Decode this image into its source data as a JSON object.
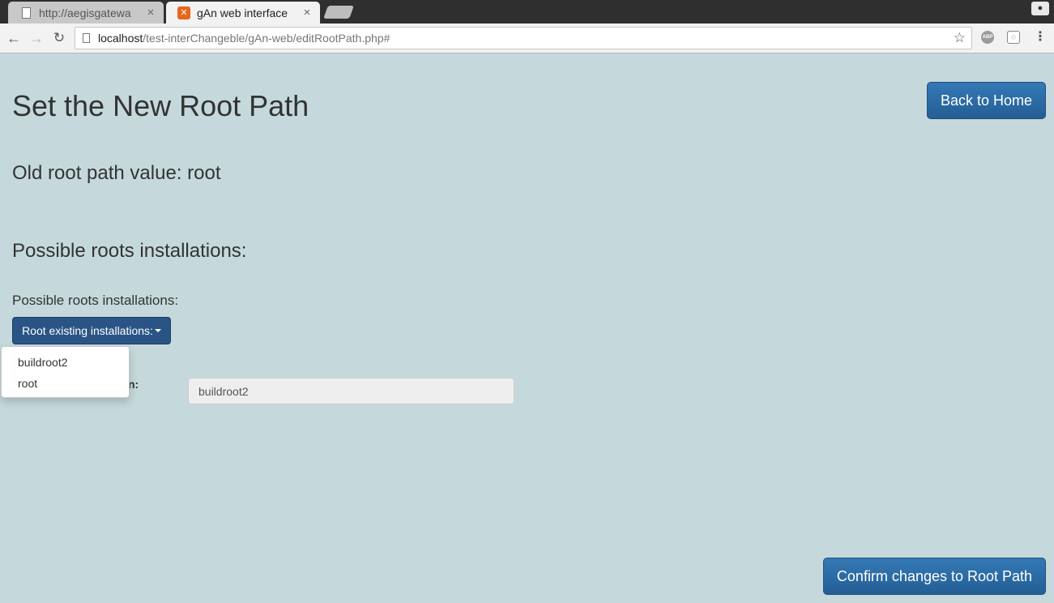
{
  "browser": {
    "tabs": [
      {
        "title": "http://aegisgatewa",
        "close": "×"
      },
      {
        "title": "gAn web interface",
        "close": "×"
      }
    ],
    "url_host": "localhost",
    "url_path": "/test-interChangeble/gAn-web/editRootPath.php#"
  },
  "page": {
    "title": "Set the New Root Path",
    "back_button": "Back to Home",
    "old_root": "Old root path value: root",
    "section_heading": "Possible roots installations:",
    "field_label": "Possible roots installations:",
    "dropdown_button": "Root existing installations:",
    "dropdown_options": [
      "buildroot2",
      "root"
    ],
    "new_root_label_suffix": "n:",
    "root_input_value": "buildroot2",
    "confirm_button": "Confirm changes to Root Path"
  },
  "colors": {
    "page_background": "#c5d9dc",
    "primary_button": "#2a6aa6",
    "dropdown_button": "#2a5486"
  }
}
